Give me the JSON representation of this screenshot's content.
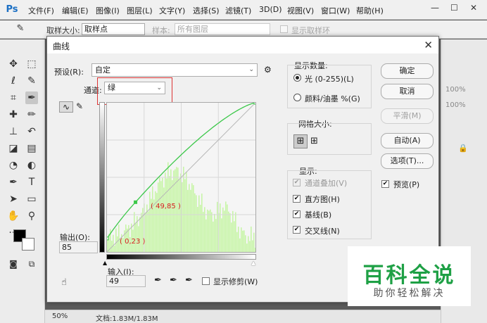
{
  "app": {
    "logo": "Ps",
    "menu": [
      "文件(F)",
      "编辑(E)",
      "图像(I)",
      "图层(L)",
      "文字(Y)",
      "选择(S)",
      "滤镜(T)",
      "3D(D)",
      "视图(V)",
      "窗口(W)",
      "帮助(H)"
    ],
    "window_controls": [
      "—",
      "☐",
      "✕"
    ]
  },
  "options_bar": {
    "sample_size_label": "取样大小:",
    "sample_size_value": "取样点",
    "sample_label": "样本:",
    "sample_value": "所有图层",
    "show_ring_label": "显示取样环"
  },
  "right_panel": {
    "zoom_1": "100%",
    "zoom_2": "100%"
  },
  "status_bar": {
    "zoom": "50%",
    "doc_info": "文档:1.83M/1.83M"
  },
  "dialog": {
    "title": "曲线",
    "close": "✕",
    "preset_label": "预设(R):",
    "preset_value": "自定",
    "channel_label": "通道:",
    "channel_value": "绿",
    "output_label": "输出(O):",
    "output_value": "85",
    "input_label": "输入(I):",
    "input_value": "49",
    "show_clipping_label": "显示修剪(W)",
    "point_label_1": "( 49,85 )",
    "point_label_2": "( 0,23 )",
    "show_amount": {
      "title": "显示数量:",
      "light": "光 (0-255)(L)",
      "pigment": "颜料/油墨 %(G)",
      "selected": "light"
    },
    "grid_size": {
      "title": "网格大小:"
    },
    "show": {
      "title": "显示:",
      "channel_overlays": "通道叠加(V)",
      "histogram": "直方图(H)",
      "baseline": "基线(B)",
      "intersection": "交叉线(N)"
    },
    "buttons": {
      "ok": "确定",
      "cancel": "取消",
      "smooth": "平滑(M)",
      "auto": "自动(A)",
      "options": "选项(T)..."
    },
    "preview_label": "预览(P)"
  },
  "watermark": {
    "main": "百科全说",
    "sub": "助你轻松解决"
  },
  "colors": {
    "curve": "#3cc84a",
    "histogram": "#c8f5a8",
    "highlight_box": "#dd3333",
    "point_label": "#d62020",
    "watermark_green": "#1ea045"
  }
}
